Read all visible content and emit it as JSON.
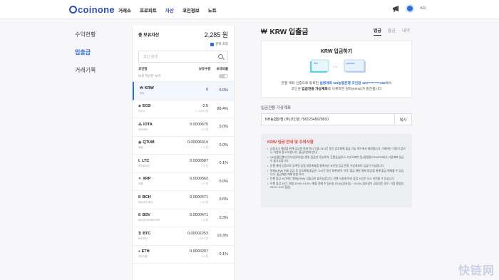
{
  "header": {
    "logo": "coinone",
    "nav": [
      "거래소",
      "프로피트",
      "자산",
      "코인정보",
      "노트"
    ],
    "active_nav": 2,
    "lang": "KR"
  },
  "leftmenu": [
    "수익현황",
    "입출금",
    "거래기록"
  ],
  "assets": {
    "title": "총 보유자산",
    "total": "2,285 원",
    "krw_toggle": "원화 포함",
    "search_placeholder": "코인 검색",
    "col_coin": "코인명",
    "col_qty": "보유수량",
    "col_ratio": "보유비율",
    "held_only": "보유 자산만 보기",
    "rows": [
      {
        "sym": "KRW",
        "icon": "₩",
        "name": "원화",
        "amt": "0",
        "krw": "",
        "pct": "0.0%"
      },
      {
        "sym": "EOS",
        "icon": "◈",
        "name": "이오스",
        "amt": "0.5",
        "krw": "≈ 2,000 원",
        "pct": "88.4%"
      },
      {
        "sym": "IOTA",
        "icon": "⁂",
        "name": "아이오타",
        "amt": "0.0000675",
        "krw": "≈ 0 원",
        "pct": "0.0%"
      },
      {
        "sym": "QTUM",
        "icon": "◉",
        "name": "퀀텀",
        "amt": "0.00006314",
        "krw": "≈ 0 원",
        "pct": "0.0%"
      },
      {
        "sym": "LTC",
        "icon": "Ł",
        "name": "라이트코인",
        "amt": "0.0000587",
        "krw": "≈ 4 원",
        "pct": "0.1%"
      },
      {
        "sym": "XRP",
        "icon": "✕",
        "name": "리플",
        "amt": "0.0000562",
        "krw": "≈ 0 원",
        "pct": "0.0%"
      },
      {
        "sym": "BCH",
        "icon": "Ƀ",
        "name": "비트코인 캐시",
        "amt": "0.0000471",
        "krw": "≈ 13 원",
        "pct": "0.6%"
      },
      {
        "sym": "BSV",
        "icon": "Ƀ",
        "name": "비트코인SV에스브이",
        "amt": "0.0000471",
        "krw": "≈ 5 원",
        "pct": "0.3%"
      },
      {
        "sym": "BTC",
        "icon": "₿",
        "name": "비트코인",
        "amt": "0.00002253",
        "krw": "≈ 233 원",
        "pct": "10.3%"
      },
      {
        "sym": "ETH",
        "icon": "♦",
        "name": "이더리움",
        "amt": "0.0000207",
        "krw": "≈ 3 원",
        "pct": "0.1%"
      }
    ]
  },
  "main": {
    "title": "KRW 입출금",
    "tabs": [
      "입금",
      "출금",
      "내역"
    ],
    "card_title": "KRW 입금하기",
    "diagram_left": "NH",
    "diagram_right": "coinone",
    "desc_line1_a": "은행 계좌 인증으로 등록된 ",
    "desc_line1_b": "실명계좌 NH농협은행 코인원 123*********456",
    "desc_line1_c": "에서",
    "desc_line2_a": "코인원 ",
    "desc_line2_b": "입금전용 가상계좌",
    "desc_line2_c": "로 이체하면 원화(KRW)가 충전됩니다",
    "acct_label": "입금전용 가상계좌",
    "acct_value": "NH농협은행 (주)코인원 79012345678910",
    "copy": "복사",
    "notice_title": "KRW 입금 안내 및 주의사항",
    "notices": [
      "금융사고 예방을 위해 입금된 원화 역시 인출 24시간 동안 암호화폐 출금 가능 액수에서 제외됩니다. 거래에는 이용이 없으니 이용에 참고 바랍니다. 출금지연제 안내",
      "NH농협은행과 인터넷(모바일) 뱅킹 입금만 가능하며, 간편송금(토스,카카오페이 등)/펌뱅킹/CD/ATM에서 가상계좌 입금이 불가능합니다.",
      "은행 계좌 인증으로 등록된 농협 실명계좌를 통해서만 코인원 입금 전용 가상계좌로 입금이 가능합니다",
      "원화(KRW) 최초 입금 후 암호화폐 출금은 72시간 동안 제한되며, 이후 '출금 제한 해제 방법'을 통해 출금 해제할 수 있습니다. 출금제한 해제 방법 보기",
      "은행 점검 시간에는 원화(KRW) 입출금이 불가능합니다. 은행 사정에 따라 점검 시간은 다소 지연될 수 있습니다",
      "은행 점검 시간 : 매일 23:00~01:00 / 매월 셋째 주 일요일 23:00(일요일) ~ 04:00 (일요일이 공휴일인 경우, 다음 평일일 23:00~4:00 점검)"
    ]
  },
  "colors": {
    "accent": "#2b6fdc",
    "warning": "#e0443b"
  },
  "watermark": "快链网"
}
